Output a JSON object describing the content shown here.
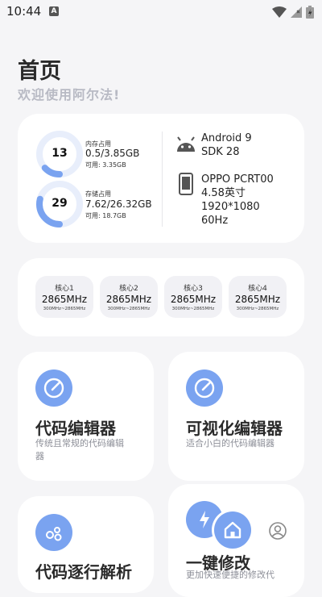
{
  "status_bar": {
    "time": "10:44",
    "notification_badge": "A",
    "icons": [
      "wifi-icon",
      "signal-icon",
      "battery-icon"
    ]
  },
  "header": {
    "title": "首页",
    "subtitle": "欢迎使用阿尔法!"
  },
  "storage_card": {
    "memory": {
      "percent": "13",
      "label": "内存占用",
      "value": "0.5/3.85GB",
      "free": "可用: 3.35GB",
      "fraction": 0.13
    },
    "storage": {
      "percent": "29",
      "label": "存储占用",
      "value": "7.62/26.32GB",
      "free": "可用: 18.7GB",
      "fraction": 0.29
    },
    "android": {
      "version": "Android 9",
      "sdk": "SDK 28"
    },
    "device": {
      "model": "OPPO PCRT00",
      "screen_size": "4.58英寸",
      "resolution": "1920*1080",
      "refresh_rate": "60Hz"
    }
  },
  "cpu_card": {
    "cores": [
      {
        "name": "核心1",
        "freq": "2865MHz",
        "range": "300MHz~2865MHz"
      },
      {
        "name": "核心2",
        "freq": "2865MHz",
        "range": "300MHz~2865MHz"
      },
      {
        "name": "核心3",
        "freq": "2865MHz",
        "range": "300MHz~2865MHz"
      },
      {
        "name": "核心4",
        "freq": "2865MHz",
        "range": "300MHz~2865MHz"
      }
    ]
  },
  "tiles": [
    {
      "title": "代码编辑器",
      "desc1": "传统且常规的代码编辑",
      "desc2": "器"
    },
    {
      "title": "可视化编辑器",
      "desc1": "适合小白的代码编辑器",
      "desc2": ""
    },
    {
      "title": "代码逐行解析",
      "desc1": "",
      "desc2": ""
    },
    {
      "title": "一键修改",
      "desc1": "更加快速便捷的修改代",
      "desc2": ""
    }
  ],
  "colors": {
    "accent": "#7aa3f0",
    "ring_track": "#e8eefb",
    "background": "#f5f5f7"
  }
}
